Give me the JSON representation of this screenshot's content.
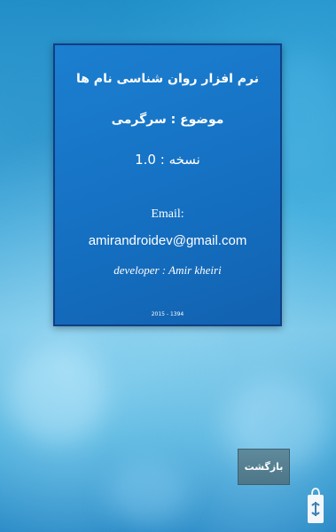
{
  "about": {
    "app_title": "نرم افزار روان شناسی نام ها",
    "subject": "موضوع : سرگرمی",
    "version": "نسخه : 1.0",
    "email_label": "Email:",
    "email_address": "amirandroidev@gmail.com",
    "developer": "developer : Amir kheiri",
    "years": "2015 - 1394"
  },
  "back_button": {
    "label": "بازگشت"
  },
  "icons": {
    "store_badge": "shopping-bag-icon"
  },
  "colors": {
    "card_background": "#1570c2",
    "card_border": "#0e3e86",
    "button_background": "#557f91",
    "text": "#ffffff"
  }
}
